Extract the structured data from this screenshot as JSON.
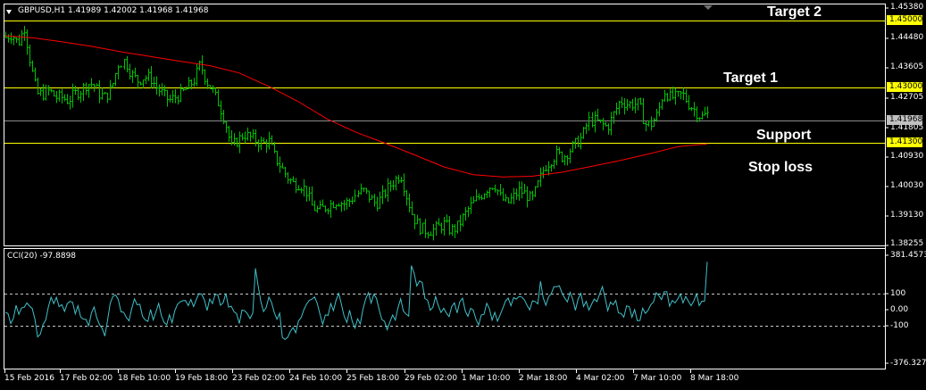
{
  "window": {
    "symbol_header": "GBPUSD,H1  1.41989 1.42002 1.41968 1.41968",
    "menu_icon": "triangle-down-icon"
  },
  "indicator": {
    "header": "CCI(20) -97.8898",
    "scale_labels": [
      "381.4573",
      "100",
      "0.00",
      "-100",
      "-376.3271"
    ]
  },
  "annotations": {
    "target2": "Target 2",
    "target1": "Target 1",
    "support": "Support",
    "stoploss": "Stop loss"
  },
  "colors": {
    "background": "#000000",
    "candles": "#00c000",
    "ma_line": "#ff0000",
    "level_lines": "#ffff00",
    "cci_line": "#40c0c8",
    "text": "#ffffff"
  },
  "chart_data": [
    {
      "type": "candlestick",
      "symbol": "GBPUSD",
      "timeframe": "H1",
      "ylim": [
        1.38255,
        1.4538
      ],
      "y_tick_labels": [
        "1.45380",
        "1.44480",
        "1.43605",
        "1.42705",
        "1.41805",
        "1.40930",
        "1.40030",
        "1.39130",
        "1.38255"
      ],
      "price_tags": [
        "1.45000",
        "1.43000",
        "1.41968",
        "1.41300"
      ],
      "levels": [
        {
          "label": "Target 2",
          "price": 1.45
        },
        {
          "label": "Target 1",
          "price": 1.43
        },
        {
          "label": "Support",
          "price": 1.413
        }
      ],
      "current_price": 1.41968,
      "x_tick_labels": [
        "15 Feb 2016",
        "17 Feb 02:00",
        "18 Feb 10:00",
        "19 Feb 18:00",
        "23 Feb 02:00",
        "24 Feb 10:00",
        "25 Feb 18:00",
        "29 Feb 02:00",
        "1 Mar 10:00",
        "2 Mar 18:00",
        "4 Mar 02:00",
        "7 Mar 10:00",
        "8 Mar 18:00"
      ],
      "close_path": [
        1.445,
        1.446,
        1.443,
        1.448,
        1.437,
        1.428,
        1.428,
        1.429,
        1.427,
        1.427,
        1.426,
        1.428,
        1.429,
        1.431,
        1.431,
        1.428,
        1.427,
        1.43,
        1.437,
        1.438,
        1.434,
        1.432,
        1.433,
        1.433,
        1.43,
        1.428,
        1.426,
        1.427,
        1.428,
        1.43,
        1.432,
        1.437,
        1.432,
        1.429,
        1.425,
        1.42,
        1.412,
        1.414,
        1.416,
        1.415,
        1.414,
        1.413,
        1.414,
        1.409,
        1.406,
        1.403,
        1.401,
        1.401,
        1.399,
        1.394,
        1.393,
        1.394,
        1.395,
        1.396,
        1.395,
        1.396,
        1.398,
        1.399,
        1.397,
        1.395,
        1.397,
        1.4,
        1.402,
        1.404,
        1.397,
        1.391,
        1.388,
        1.387,
        1.387,
        1.388,
        1.389,
        1.387,
        1.388,
        1.391,
        1.394,
        1.396,
        1.398,
        1.4,
        1.401,
        1.397,
        1.395,
        1.397,
        1.399,
        1.398,
        1.396,
        1.401,
        1.406,
        1.408,
        1.41,
        1.409,
        1.411,
        1.413,
        1.415,
        1.42,
        1.42,
        1.419,
        1.418,
        1.422,
        1.426,
        1.425,
        1.425,
        1.425,
        1.419,
        1.419,
        1.422,
        1.429,
        1.427,
        1.427,
        1.428,
        1.425,
        1.423,
        1.421,
        1.422
      ],
      "ma_path": [
        1.4455,
        1.4448,
        1.4436,
        1.4422,
        1.4406,
        1.4392,
        1.4378,
        1.4365,
        1.4343,
        1.4303,
        1.4258,
        1.4205,
        1.4165,
        1.4132,
        1.4097,
        1.4061,
        1.4038,
        1.4031,
        1.4033,
        1.4045,
        1.4062,
        1.408,
        1.41,
        1.4122,
        1.413
      ],
      "cci_reference_lines": [
        100,
        -100
      ]
    },
    {
      "type": "line",
      "name": "CCI(20)",
      "ylim": [
        -376.3271,
        381.4573
      ],
      "last_value": -97.8898
    }
  ]
}
